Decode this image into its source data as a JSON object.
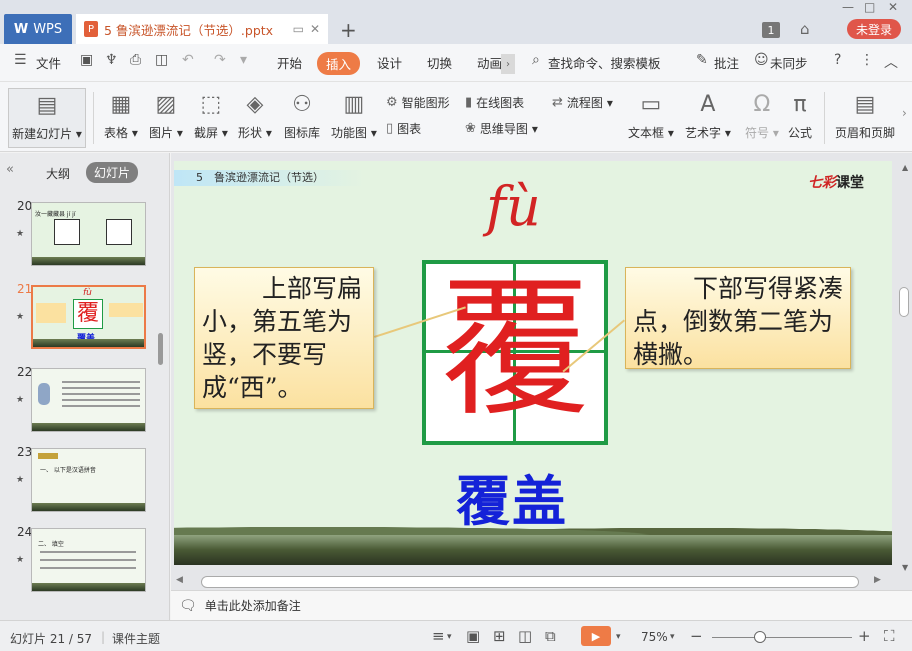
{
  "titlebar": {
    "app_tab": "WPS",
    "doc_tab_title": "5 鲁滨逊漂流记（节选）.pptx",
    "window_count": "1",
    "login_label": "未登录"
  },
  "menubar": {
    "file": "文件",
    "tabs": [
      "开始",
      "插入",
      "设计",
      "切换",
      "动画"
    ],
    "search_placeholder": "查找命令、搜索模板",
    "comment": "批注",
    "sync": "未同步"
  },
  "ribbon": {
    "new_slide": "新建幻灯片",
    "table": "表格",
    "picture": "图片",
    "screenshot": "截屏",
    "shape": "形状",
    "icon_lib": "图标库",
    "func_graph": "功能图",
    "smart_art": "智能图形",
    "online_chart": "在线图表",
    "flowchart": "流程图",
    "chart": "图表",
    "mind_map": "思维导图",
    "textbox": "文本框",
    "word_art": "艺术字",
    "symbol": "符号",
    "formula": "公式",
    "header_footer": "页眉和页脚"
  },
  "left_panel": {
    "outline_tab": "大纲",
    "slides_tab": "幻灯片",
    "thumbnails": [
      {
        "num": "20",
        "text": "汝一藏藏县 jí jí"
      },
      {
        "num": "21",
        "text": "覆盖",
        "selected": true
      },
      {
        "num": "22",
        "text": ""
      },
      {
        "num": "23",
        "text": "一、 以下是汉语拼音"
      },
      {
        "num": "24",
        "text": "二、 填空"
      }
    ]
  },
  "slide": {
    "header": "5　鲁滨逊漂流记（节选）",
    "logo_mark": "七彩",
    "logo_text": "课堂",
    "pinyin": "fù",
    "character": "覆",
    "left_note": "上部写扁小，第五笔为竖，不要写成“西”。",
    "right_note": "下部写得紧凑点，倒数第二笔为横撇。",
    "word": "覆盖"
  },
  "notes": {
    "placeholder": "单击此处添加备注"
  },
  "statusbar": {
    "slide_counter": "幻灯片 21 / 57",
    "theme": "课件主题",
    "zoom": "75%"
  },
  "colors": {
    "accent_orange": "#ee7b46",
    "wps_blue": "#3d6fb8",
    "login_red": "#e0564a",
    "char_red": "#e02020",
    "word_blue": "#1422d8",
    "grid_green": "#1f9b45"
  }
}
